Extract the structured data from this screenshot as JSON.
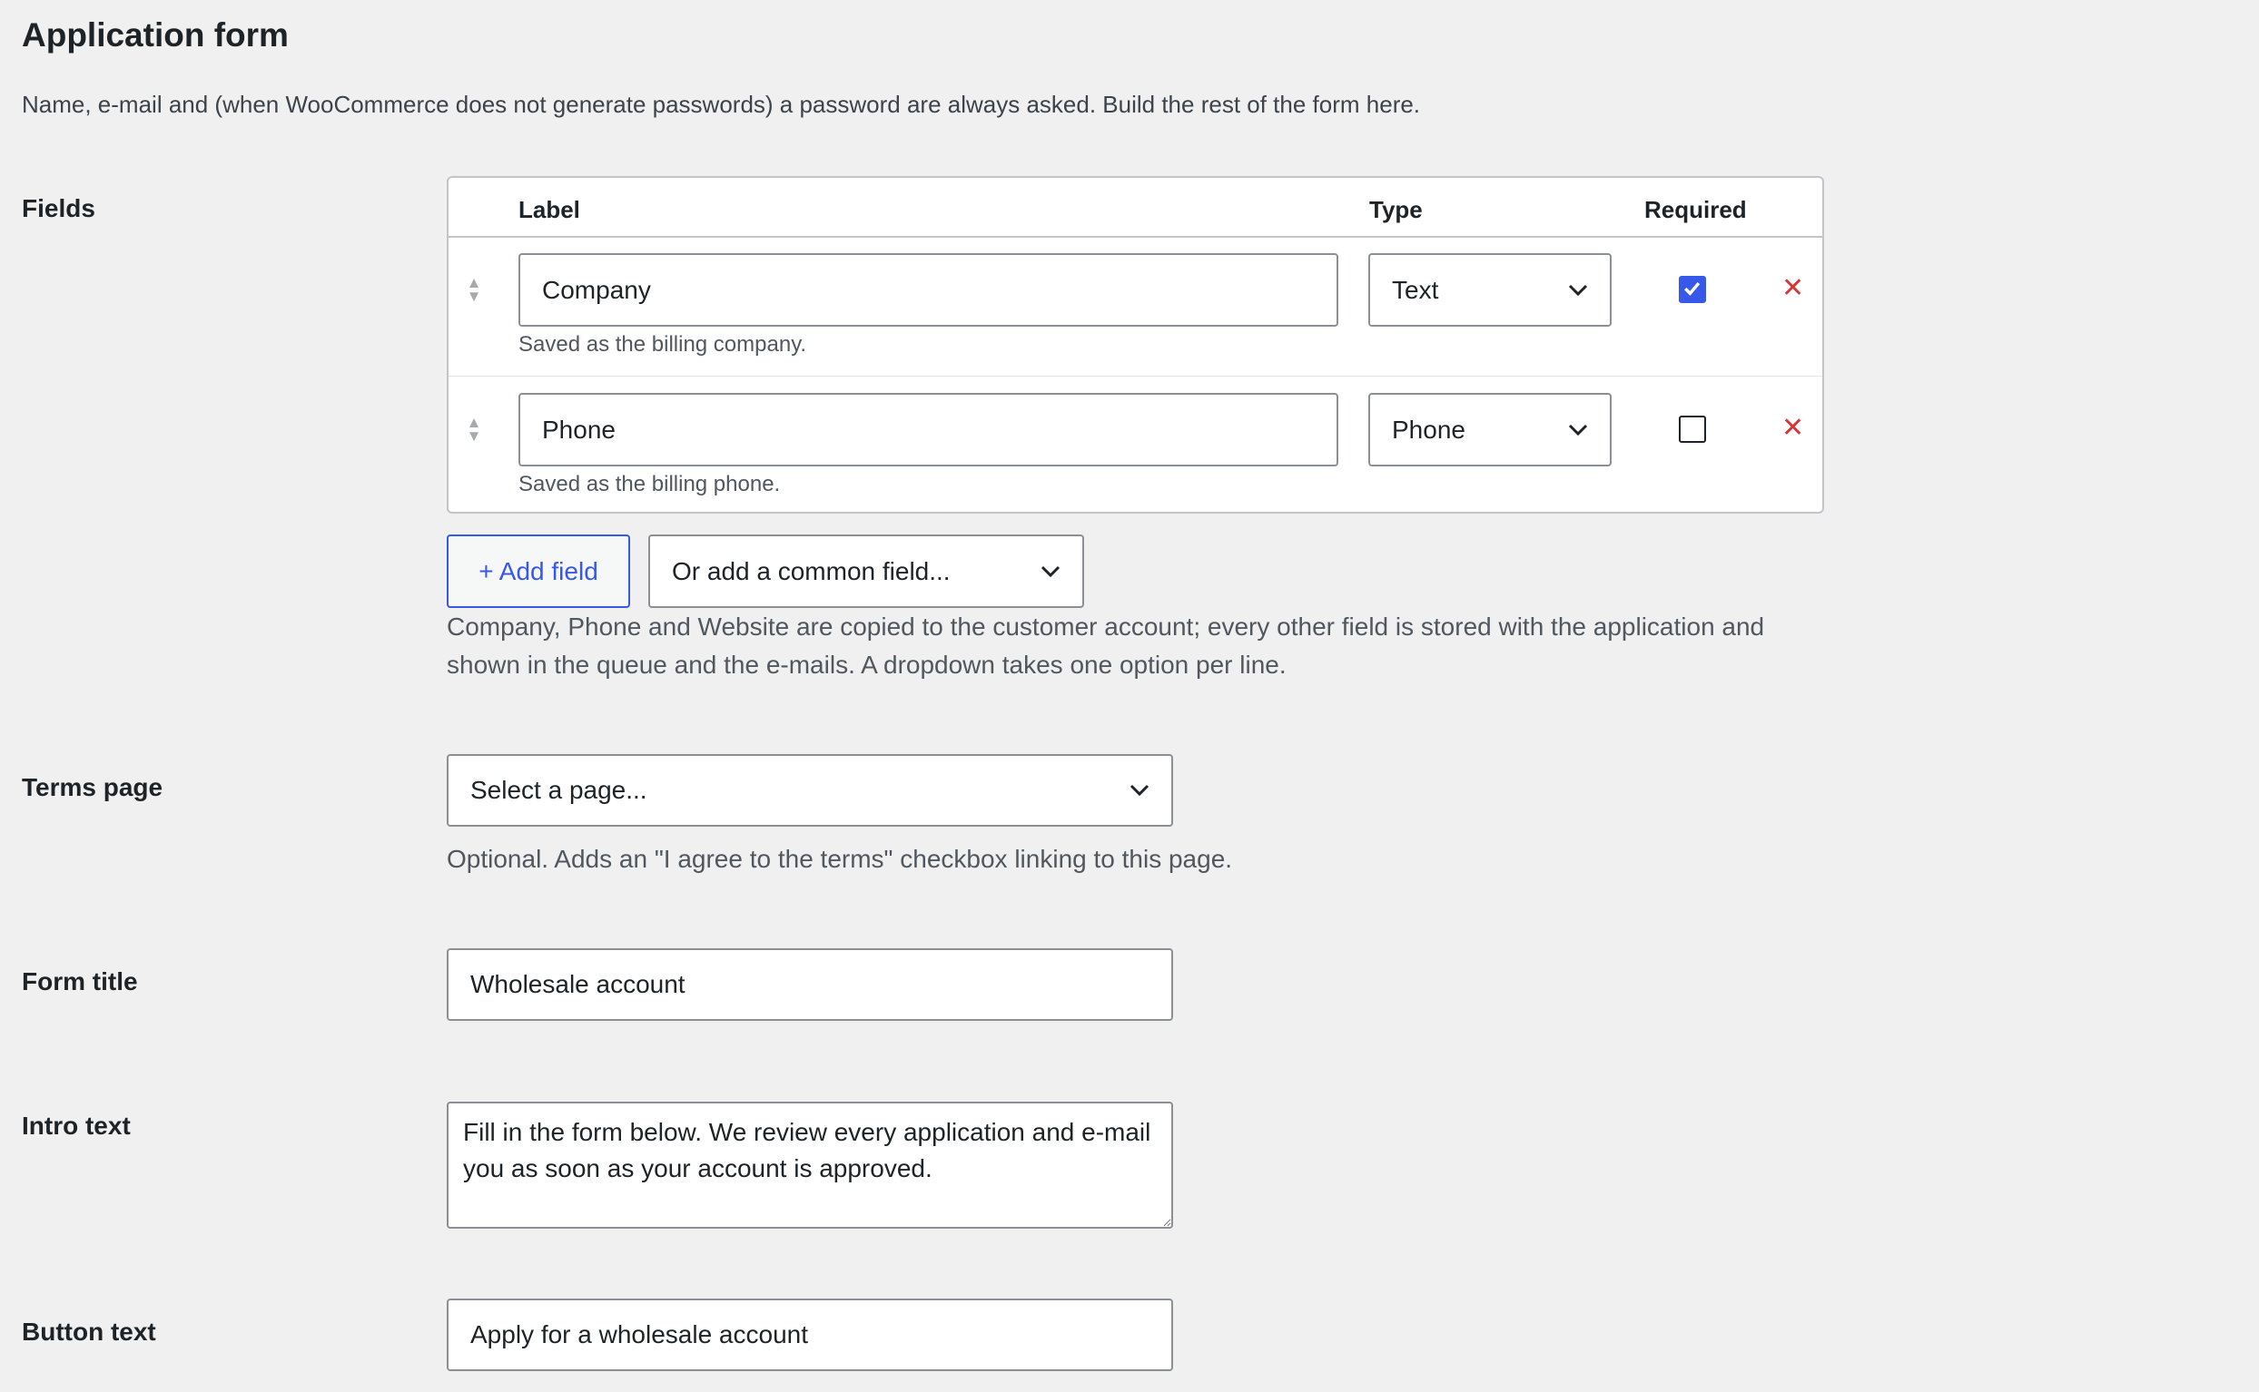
{
  "header": {
    "title": "Application form",
    "description": "Name, e-mail and (when WooCommerce does not generate passwords) a password are always asked. Build the rest of the form here."
  },
  "fields_section": {
    "label": "Fields",
    "columns": {
      "label": "Label",
      "type": "Type",
      "required": "Required"
    },
    "rows": [
      {
        "label_value": "Company",
        "type": "Text",
        "required": true,
        "hint": "Saved as the billing company."
      },
      {
        "label_value": "Phone",
        "type": "Phone",
        "required": false,
        "hint": "Saved as the billing phone."
      }
    ],
    "add_field_label": "+ Add field",
    "common_field_select": "Or add a common field...",
    "help_line1": "Company, Phone and Website are copied to the customer account; every other field is stored with the application and",
    "help_line2": "shown in the queue and the e-mails. A dropdown takes one option per line."
  },
  "terms_page": {
    "label": "Terms page",
    "select_value": "Select a page...",
    "help": "Optional. Adds an \"I agree to the terms\" checkbox linking to this page."
  },
  "form_title": {
    "label": "Form title",
    "value": "Wholesale account"
  },
  "intro_text": {
    "label": "Intro text",
    "value": "Fill in the form below. We review every application and e-mail you as soon as your account is approved."
  },
  "button_text": {
    "label": "Button text",
    "value": "Apply for a wholesale account"
  },
  "colors": {
    "accent": "#3858e9",
    "remove": "#d63638",
    "background": "#f0f0f1"
  },
  "icons": {
    "drag": "drag-handle-icon",
    "remove": "close-icon",
    "chevron": "chevron-down-icon",
    "check": "checkmark-icon"
  }
}
